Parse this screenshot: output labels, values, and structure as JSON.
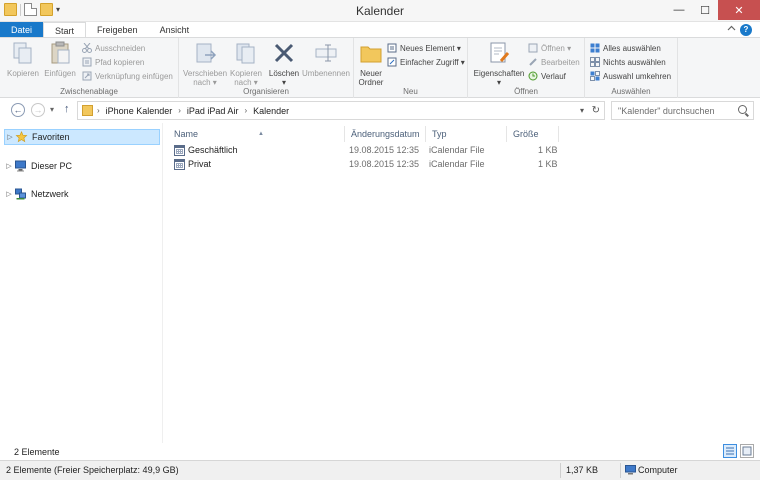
{
  "window": {
    "title": "Kalender",
    "min_glyph": "—",
    "max_glyph": "☐",
    "close_glyph": "✕"
  },
  "qat": {
    "dropdown_glyph": "▾"
  },
  "ribbon_tabs": [
    {
      "label": "Datei"
    },
    {
      "label": "Start"
    },
    {
      "label": "Freigeben"
    },
    {
      "label": "Ansicht"
    }
  ],
  "ribbon": {
    "clipboard": {
      "label": "Zwischenablage",
      "copy": "Kopieren",
      "paste": "Einfügen",
      "cut": "Ausschneiden",
      "copy_path": "Pfad kopieren",
      "paste_shortcut": "Verknüpfung einfügen"
    },
    "organize": {
      "label": "Organisieren",
      "move_to_1": "Verschieben",
      "move_to_2": "nach ▾",
      "copy_to_1": "Kopieren",
      "copy_to_2": "nach ▾",
      "delete": "Löschen",
      "delete_dd": "▾",
      "rename": "Umbenennen"
    },
    "new": {
      "label": "Neu",
      "new_folder_1": "Neuer",
      "new_folder_2": "Ordner",
      "new_item": "Neues Element ▾",
      "easy_access": "Einfacher Zugriff ▾"
    },
    "open": {
      "label": "Öffnen",
      "properties": "Eigenschaften",
      "properties_dd": "▾",
      "open": "Öffnen ▾",
      "edit": "Bearbeiten",
      "history": "Verlauf"
    },
    "select": {
      "label": "Auswählen",
      "select_all": "Alles auswählen",
      "select_none": "Nichts auswählen",
      "invert": "Auswahl umkehren"
    }
  },
  "navigation": {
    "back": "←",
    "forward": "→",
    "recent": "▾",
    "up": "↑",
    "breadcrumbs": [
      "iPhone Kalender",
      "iPad iPad Air",
      "Kalender"
    ],
    "crumb_separator": "›",
    "crumb_dropdown": "▾",
    "refresh": "↻",
    "search_placeholder": "\"Kalender\" durchsuchen"
  },
  "nav_pane": [
    {
      "label": "Favoriten",
      "selected": true
    },
    {
      "label": "Dieser PC",
      "selected": false
    },
    {
      "label": "Netzwerk",
      "selected": false
    }
  ],
  "nav_expander": "▷",
  "columns": {
    "name": "Name",
    "date": "Änderungsdatum",
    "type": "Typ",
    "size": "Größe",
    "sort_arrow": "▲"
  },
  "files": [
    {
      "name": "Geschäftlich",
      "date": "19.08.2015 12:35",
      "type": "iCalendar File",
      "size": "1 KB"
    },
    {
      "name": "Privat",
      "date": "19.08.2015 12:35",
      "type": "iCalendar File",
      "size": "1 KB"
    }
  ],
  "status": {
    "item_count": "2 Elemente",
    "details": "2 Elemente (Freier Speicherplatz: 49,9 GB)",
    "size": "1,37 KB",
    "location": "Computer"
  },
  "colors": {
    "accent": "#1979ca",
    "selection": "#cce8ff",
    "close": "#c75050"
  }
}
